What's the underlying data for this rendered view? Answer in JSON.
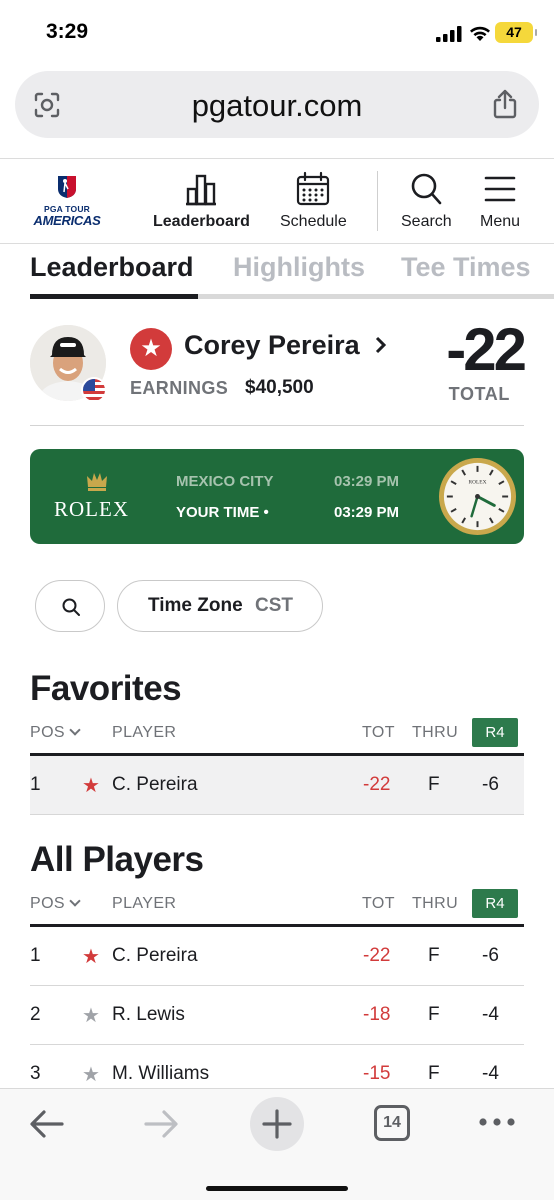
{
  "status_bar": {
    "time": "3:29",
    "battery": "47"
  },
  "browser": {
    "url": "pgatour.com",
    "tabs_count": "14"
  },
  "site_nav": {
    "logo_line1": "PGA TOUR",
    "logo_line2": "AMERICAS",
    "items": [
      {
        "label": "Leaderboard",
        "icon": "bar-chart-icon",
        "active": true
      },
      {
        "label": "Schedule",
        "icon": "calendar-icon"
      },
      {
        "label": "Search",
        "icon": "search-icon"
      },
      {
        "label": "Menu",
        "icon": "hamburger-menu-icon"
      }
    ]
  },
  "tabs": [
    {
      "label": "Leaderboard",
      "active": true
    },
    {
      "label": "Highlights"
    },
    {
      "label": "Tee Times"
    }
  ],
  "player": {
    "name": "Corey Pereira",
    "earnings_label": "EARNINGS",
    "earnings_value": "$40,500",
    "total": "-22",
    "total_label": "TOTAL"
  },
  "rolex": {
    "brand": "ROLEX",
    "clock_label": "ROLEX",
    "city_label": "MEXICO CITY",
    "city_time": "03:29 PM",
    "your_time_label": "YOUR TIME •",
    "your_time": "03:29 PM"
  },
  "filters": {
    "timezone_label": "Time Zone",
    "timezone_value": "CST"
  },
  "table_headers": {
    "pos": "POS",
    "player": "PLAYER",
    "tot": "TOT",
    "thru": "THRU",
    "round": "R4"
  },
  "favorites": {
    "title": "Favorites",
    "rows": [
      {
        "pos": "1",
        "star": "★",
        "player": "C. Pereira",
        "tot": "-22",
        "thru": "F",
        "r4": "-6"
      }
    ]
  },
  "all_players": {
    "title": "All Players",
    "rows": [
      {
        "pos": "1",
        "star": "★",
        "player": "C. Pereira",
        "tot": "-22",
        "thru": "F",
        "r4": "-6"
      },
      {
        "pos": "2",
        "star": "★",
        "player": "R. Lewis",
        "tot": "-18",
        "thru": "F",
        "r4": "-4"
      },
      {
        "pos": "3",
        "star": "★",
        "player": "M. Williams",
        "tot": "-15",
        "thru": "F",
        "r4": "-4"
      }
    ]
  },
  "colors": {
    "accent_red": "#d23b3b",
    "rolex_green": "#1f6b3b",
    "round_green": "#2d7a4c",
    "text": "#1c1d21"
  }
}
